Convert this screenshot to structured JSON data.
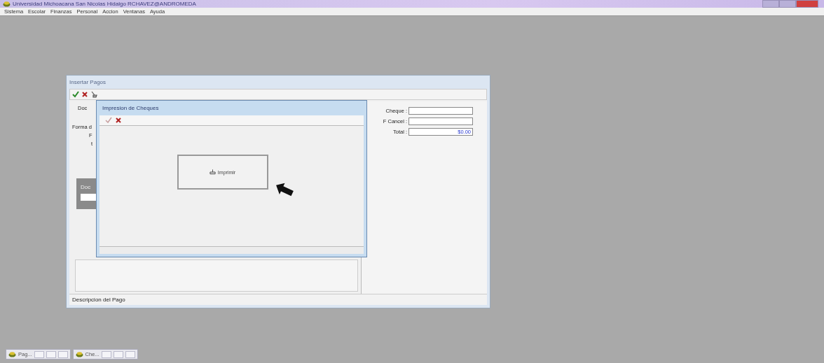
{
  "window": {
    "title": "Universidad Michoacana San Nicolas Hidalgo RCHAVEZ@ANDROMEDA"
  },
  "menu": [
    "Sistema",
    "Escolar",
    "Finanzas",
    "Personal",
    "Accion",
    "Ventanas",
    "Ayuda"
  ],
  "form": {
    "title": "Insertar Pagos",
    "left_labels": [
      "Doc",
      "Forma d",
      "F",
      "t"
    ],
    "group_label": "Doc",
    "fields": [
      {
        "label": "Cheque :"
      },
      {
        "label": "F Cancel :"
      },
      {
        "label": "Total :",
        "value": "$0.00"
      }
    ],
    "status": "Descripcion del Pago"
  },
  "dialog": {
    "title": "Impresion de Cheques",
    "accept_disabled": true,
    "button": "Imprimir"
  },
  "minimized": [
    {
      "label": "Pag..."
    },
    {
      "label": "Che..."
    }
  ]
}
